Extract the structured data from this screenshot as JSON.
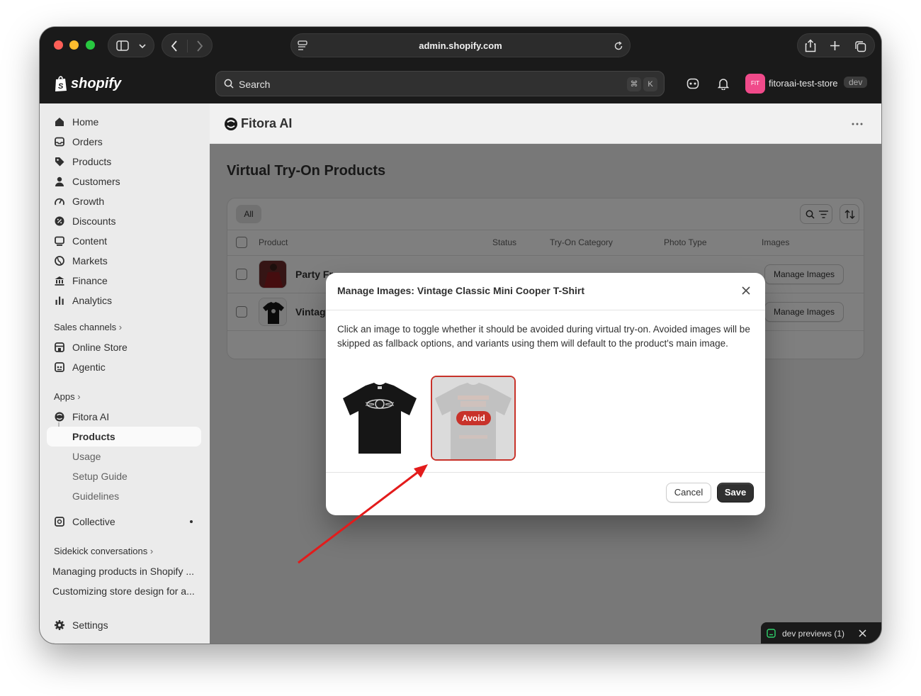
{
  "browser": {
    "url": "admin.shopify.com"
  },
  "topbar": {
    "logo_text": "shopify",
    "search_placeholder": "Search",
    "shortcut_key1": "⌘",
    "shortcut_key2": "K",
    "store_initials": "FIT",
    "store_name": "fitoraai-test-store",
    "store_badge": "dev"
  },
  "sidebar": {
    "items": [
      {
        "label": "Home"
      },
      {
        "label": "Orders"
      },
      {
        "label": "Products"
      },
      {
        "label": "Customers"
      },
      {
        "label": "Growth"
      },
      {
        "label": "Discounts"
      },
      {
        "label": "Content"
      },
      {
        "label": "Markets"
      },
      {
        "label": "Finance"
      },
      {
        "label": "Analytics"
      }
    ],
    "sales_channels_heading": "Sales channels",
    "sales_channels": [
      {
        "label": "Online Store"
      },
      {
        "label": "Agentic"
      }
    ],
    "apps_heading": "Apps",
    "app_name": "Fitora AI",
    "app_subitems": [
      {
        "label": "Products"
      },
      {
        "label": "Usage"
      },
      {
        "label": "Setup Guide"
      },
      {
        "label": "Guidelines"
      }
    ],
    "collective": "Collective",
    "sidekick_heading": "Sidekick conversations",
    "conversations": [
      {
        "label": "Managing products in Shopify ..."
      },
      {
        "label": "Customizing store design for a..."
      }
    ],
    "settings": "Settings"
  },
  "app_header": {
    "title": "Fitora AI"
  },
  "page": {
    "title": "Virtual Try-On Products",
    "filter_tab": "All",
    "columns": [
      "Product",
      "Status",
      "Try-On Category",
      "Photo Type",
      "Images"
    ],
    "rows": [
      {
        "product": "Party Fr",
        "manage": "Manage Images"
      },
      {
        "product": "Vintag",
        "manage": "Manage Images"
      }
    ]
  },
  "modal": {
    "title": "Manage Images: Vintage Classic Mini Cooper T-Shirt",
    "description": "Click an image to toggle whether it should be avoided during virtual try-on. Avoided images will be skipped as fallback options, and variants using them will default to the product's main image.",
    "avoid_label": "Avoid",
    "cancel": "Cancel",
    "save": "Save"
  },
  "dev_previews": "dev previews (1)",
  "colors": {
    "accent_danger": "#c8322a",
    "annotation_arrow": "#e31b1b"
  }
}
